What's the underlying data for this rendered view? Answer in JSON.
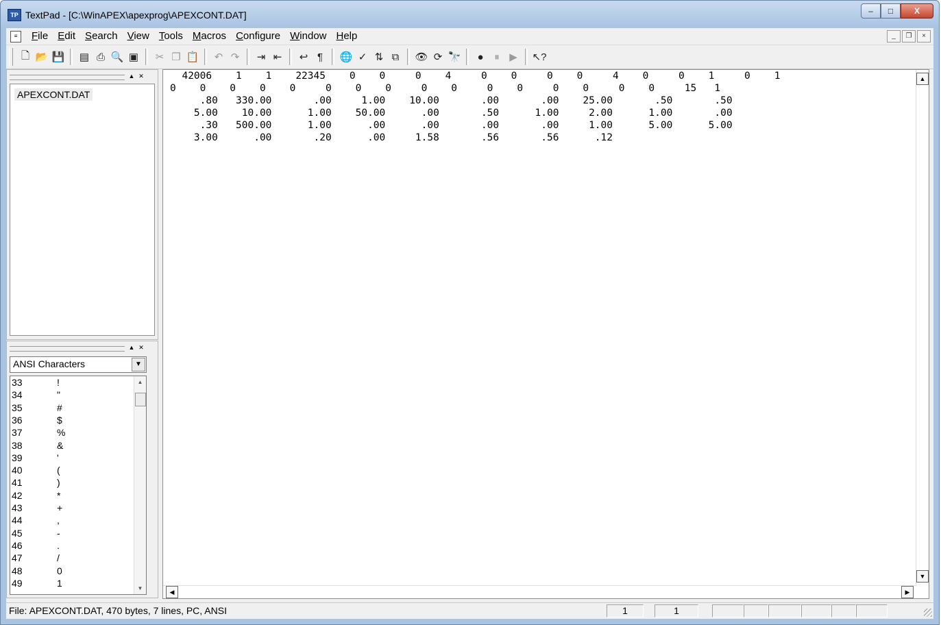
{
  "window": {
    "title": "TextPad - [C:\\WinAPEX\\apexprog\\APEXCONT.DAT]",
    "app_icon": "textpad-app-icon",
    "controls": {
      "minimize": "–",
      "maximize": "□",
      "close": "X"
    }
  },
  "menu": {
    "items": [
      "File",
      "Edit",
      "Search",
      "View",
      "Tools",
      "Macros",
      "Configure",
      "Window",
      "Help"
    ],
    "mdi_controls": {
      "minimize": "_",
      "restore": "❐",
      "close": "×"
    }
  },
  "toolbar": {
    "buttons": [
      "new-file",
      "open",
      "save",
      "save-all",
      "print",
      "print-preview",
      "view-document",
      "cut",
      "copy",
      "paste",
      "undo",
      "redo",
      "indent",
      "unindent",
      "word-wrap",
      "show-visible-spaces",
      "internet",
      "spelling",
      "sort",
      "compare",
      "find-in-files",
      "replace",
      "find",
      "record-macro",
      "pause-macro",
      "play-macro",
      "context-help"
    ]
  },
  "document_panel": {
    "documents": [
      "APEXCONT.DAT"
    ]
  },
  "clip_panel": {
    "library": "ANSI Characters",
    "chars": [
      {
        "code": "33",
        "ch": "!"
      },
      {
        "code": "34",
        "ch": "\""
      },
      {
        "code": "35",
        "ch": "#"
      },
      {
        "code": "36",
        "ch": "$"
      },
      {
        "code": "37",
        "ch": "%"
      },
      {
        "code": "38",
        "ch": "&"
      },
      {
        "code": "39",
        "ch": "'"
      },
      {
        "code": "40",
        "ch": "("
      },
      {
        "code": "41",
        "ch": ")"
      },
      {
        "code": "42",
        "ch": "*"
      },
      {
        "code": "43",
        "ch": "+"
      },
      {
        "code": "44",
        "ch": ","
      },
      {
        "code": "45",
        "ch": "-"
      },
      {
        "code": "46",
        "ch": "."
      },
      {
        "code": "47",
        "ch": "/"
      },
      {
        "code": "48",
        "ch": "0"
      },
      {
        "code": "49",
        "ch": "1"
      }
    ]
  },
  "editor": {
    "lines": [
      "  42006    1    1    22345    0    0     0    4     0    0     0    0     4    0     0    1     0    1",
      "0    0    0    0    0     0    0    0     0    0     0    0     0    0     0    0     15   1",
      "     .80   330.00       .00     1.00    10.00       .00       .00    25.00       .50       .50",
      "    5.00    10.00      1.00    50.00      .00       .50      1.00     2.00      1.00       .00",
      "     .30   500.00      1.00      .00      .00       .00       .00     1.00      5.00      5.00",
      "    3.00      .00       .20      .00     1.58       .56       .56      .12"
    ]
  },
  "status": {
    "text": "File: APEXCONT.DAT, 470 bytes, 7 lines, PC, ANSI",
    "line": "1",
    "column": "1"
  }
}
